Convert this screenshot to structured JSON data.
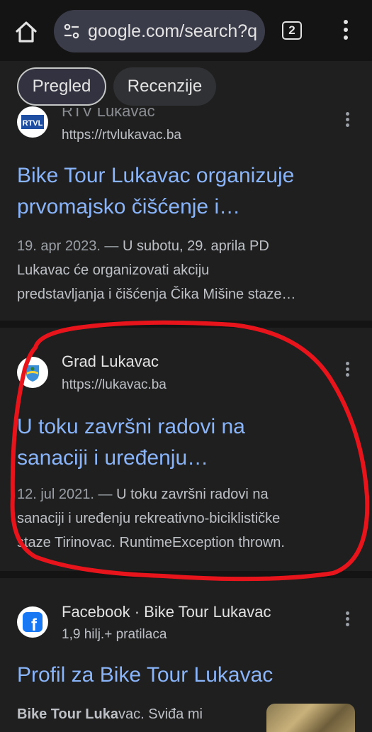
{
  "browser": {
    "url": "google.com/search?q",
    "tab_count": "2",
    "icons": [
      "home-icon",
      "tune-icon",
      "tab-switcher-icon",
      "more-vert-icon"
    ]
  },
  "chips": [
    {
      "label": "Pregled",
      "selected": true
    },
    {
      "label": "Recenzije",
      "selected": false
    }
  ],
  "results": [
    {
      "site_name": "RTV Lukavac",
      "url": "https://rtvlukavac.ba",
      "favicon_text": "RTVL",
      "title_line1": "Bike Tour Lukavac organizuje",
      "title_line2": "prvomajsko čišćenje i…",
      "date": "19. apr 2023. —",
      "snippet_line1": " U subotu, 29. aprila PD",
      "snippet_line2": "Lukavac će organizovati akciju",
      "snippet_line3": "predstavljanja i čišćenja Čika Mišine staze…"
    },
    {
      "site_name": "Grad Lukavac",
      "url": "https://lukavac.ba",
      "title_line1": "U toku završni radovi na",
      "title_line2": "sanaciji i uređenju…",
      "date": "12. jul 2021. —",
      "snippet_line1": " U toku završni radovi na",
      "snippet_line2": "sanaciji i uređenju rekreativno-biciklističke",
      "snippet_line3": "staze Tirinovac. RuntimeException thrown."
    },
    {
      "site_name": "Facebook · Bike Tour Lukavac",
      "url": "1,9 hilj.+ pratilaca",
      "favicon_text": "f",
      "title_line1": "Profil za Bike Tour Lukavac",
      "snippet_bold": "Bike Tour Luka",
      "snippet_rest": "vac. Sviđa mi"
    }
  ],
  "colors": {
    "background": "#1f1f1f",
    "link": "#8ab4f8",
    "annotation": "#e8141c"
  }
}
